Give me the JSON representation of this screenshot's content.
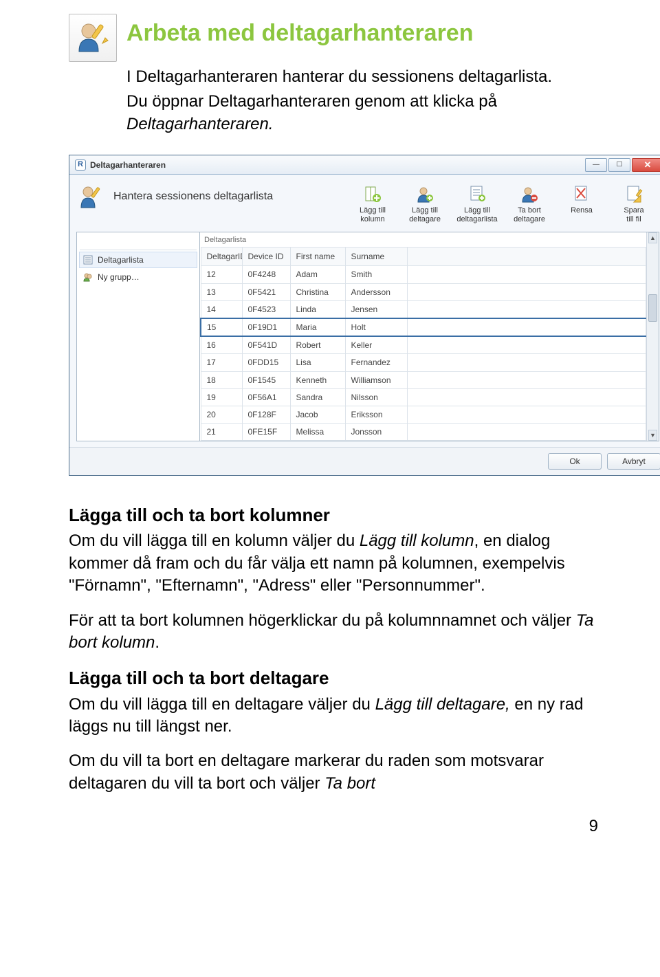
{
  "header": {
    "title": "Arbeta med deltagarhanteraren",
    "intro_line1": "I Deltagarhanteraren hanterar du sessionens deltagarlista.",
    "intro_line2_a": "Du öppnar Deltagarhanteraren genom att klicka på ",
    "intro_line2_b": "Deltagarhanteraren."
  },
  "screenshot": {
    "window_title": "Deltagarhanteraren",
    "app_badge": "R",
    "heading": "Hantera sessionens deltagarlista",
    "toolbar": [
      {
        "label": "Lägg till\nkolumn"
      },
      {
        "label": "Lägg till\ndeltagare"
      },
      {
        "label": "Lägg till\ndeltagarlista"
      },
      {
        "label": "Ta bort\ndeltagare"
      },
      {
        "label": "Rensa"
      },
      {
        "label": "Spara\ntill fil"
      }
    ],
    "sidebar": {
      "header": "",
      "items": [
        {
          "label": "Deltagarlista"
        },
        {
          "label": "Ny grupp…"
        }
      ]
    },
    "grid_label": "Deltagarlista",
    "columns": [
      "DeltagarID",
      "Device ID",
      "First name",
      "Surname"
    ],
    "selected_row_index": 3,
    "rows": [
      [
        "12",
        "0F4248",
        "Adam",
        "Smith"
      ],
      [
        "13",
        "0F5421",
        "Christina",
        "Andersson"
      ],
      [
        "14",
        "0F4523",
        "Linda",
        "Jensen"
      ],
      [
        "15",
        "0F19D1",
        "Maria",
        "Holt"
      ],
      [
        "16",
        "0F541D",
        "Robert",
        "Keller"
      ],
      [
        "17",
        "0FDD15",
        "Lisa",
        "Fernandez"
      ],
      [
        "18",
        "0F1545",
        "Kenneth",
        "Williamson"
      ],
      [
        "19",
        "0F56A1",
        "Sandra",
        "Nilsson"
      ],
      [
        "20",
        "0F128F",
        "Jacob",
        "Eriksson"
      ],
      [
        "21",
        "0FE15F",
        "Melissa",
        "Jonsson"
      ]
    ],
    "buttons": {
      "ok": "Ok",
      "cancel": "Avbryt"
    }
  },
  "section1": {
    "heading": "Lägga till och ta bort kolumner",
    "p1_a": "Om du vill lägga till en kolumn väljer du ",
    "p1_b": "Lägg till kolumn",
    "p1_c": ", en dialog kommer då fram och du får välja ett namn på kolumnen, exempelvis \"Förnamn\", \"Efternamn\", \"Adress\" eller \"Personnummer\".",
    "p2_a": "För att ta bort kolumnen högerklickar du på kolumnnamnet och väljer ",
    "p2_b": "Ta bort kolumn",
    "p2_c": "."
  },
  "section2": {
    "heading": "Lägga till och ta bort deltagare",
    "p1_a": "Om du vill lägga till en deltagare väljer du ",
    "p1_b": "Lägg till deltagare,",
    "p1_c": " en ny rad läggs nu till längst ner.",
    "p2_a": "Om du vill ta bort en deltagare markerar du raden som motsvarar deltagaren du vill ta bort och väljer ",
    "p2_b": "Ta bort"
  },
  "page_number": "9"
}
